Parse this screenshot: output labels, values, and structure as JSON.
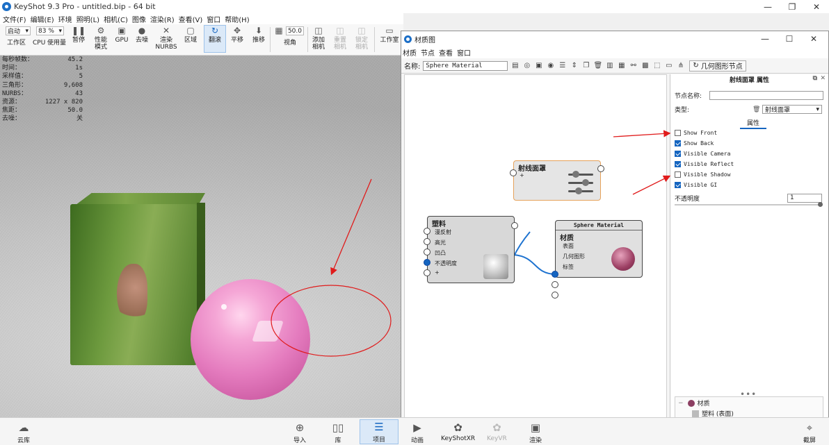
{
  "app": {
    "title": "KeyShot 9.3 Pro  - untitled.bip  - 64 bit"
  },
  "menu": [
    "文件(F)",
    "编辑(E)",
    "环境",
    "照明(L)",
    "相机(C)",
    "图像",
    "渲染(R)",
    "查看(V)",
    "窗口",
    "帮助(H)"
  ],
  "toolbar": {
    "start_select": "启动",
    "zoom_select": "83 %",
    "workspace": "工作区",
    "cpu_label": "CPU",
    "usage": "使用量",
    "pause": "暂停",
    "perf_mode": "性能\n模式",
    "gpu": "GPU",
    "denoise": "去噪",
    "render_nurbs": "渲染\nNURBS",
    "region": "区域",
    "tumble": "翻滚",
    "pan": "平移",
    "dolly": "推移",
    "fov_value": "50.0",
    "fov": "视角",
    "add_camera": "添加\n相机",
    "reset_camera": "重置\n相机",
    "lock_camera": "锁定\n相机",
    "workroom": "工作室"
  },
  "stats": [
    {
      "k": "每秒帧数：",
      "v": "45.2"
    },
    {
      "k": "时间：",
      "v": "1s"
    },
    {
      "k": "采样值：",
      "v": "5"
    },
    {
      "k": "三角形：",
      "v": "9,608"
    },
    {
      "k": "NURBS：",
      "v": "43"
    },
    {
      "k": "资源：",
      "v": "1227 x 820"
    },
    {
      "k": "焦距：",
      "v": "50.0"
    },
    {
      "k": "去噪：",
      "v": "关"
    }
  ],
  "material_window": {
    "title": "材质图",
    "menu": [
      "材质",
      "节点",
      "查看",
      "窗口"
    ],
    "name_label": "名称:",
    "name_value": "Sphere Material",
    "geo_node_button": "几何图形节点",
    "nodes": {
      "ray": {
        "title": "射线面罩",
        "plus": "+"
      },
      "plastic": {
        "title": "塑料",
        "ports": [
          "漫反射",
          "高光",
          "凹凸",
          "不透明度",
          "+"
        ]
      },
      "material": {
        "header": "Sphere Material",
        "title": "材质",
        "ports": [
          "表面",
          "几何图形",
          "标签"
        ]
      }
    },
    "props": {
      "header": "射线面罩  属性",
      "node_name_label": "节点名称:",
      "node_name_value": "",
      "type_label": "类型:",
      "type_value": "射线面罩",
      "tab": "属性",
      "checkboxes": [
        {
          "label": "Show Front",
          "checked": false
        },
        {
          "label": "Show Back",
          "checked": true
        },
        {
          "label": "Visible Camera",
          "checked": true
        },
        {
          "label": "Visible Reflect",
          "checked": true
        },
        {
          "label": "Visible Shadow",
          "checked": false
        },
        {
          "label": "Visible GI",
          "checked": true
        }
      ],
      "opacity_label": "不透明度",
      "opacity_value": "1",
      "tree": [
        {
          "label": "材质"
        },
        {
          "label": "塑料 (表面)"
        }
      ]
    }
  },
  "bottom": {
    "cloud": "云库",
    "import": "导入",
    "library": "库",
    "project": "项目",
    "animation": "动画",
    "keyshotxr": "KeyShotXR",
    "keyvr": "KeyVR",
    "render": "渲染",
    "screenshot": "截屏"
  },
  "colors": {
    "accent": "#1565c0",
    "annotation_red": "#e01b1b",
    "sphere_pink": "#e47bbe",
    "cube_green": "#6d9a3e"
  }
}
